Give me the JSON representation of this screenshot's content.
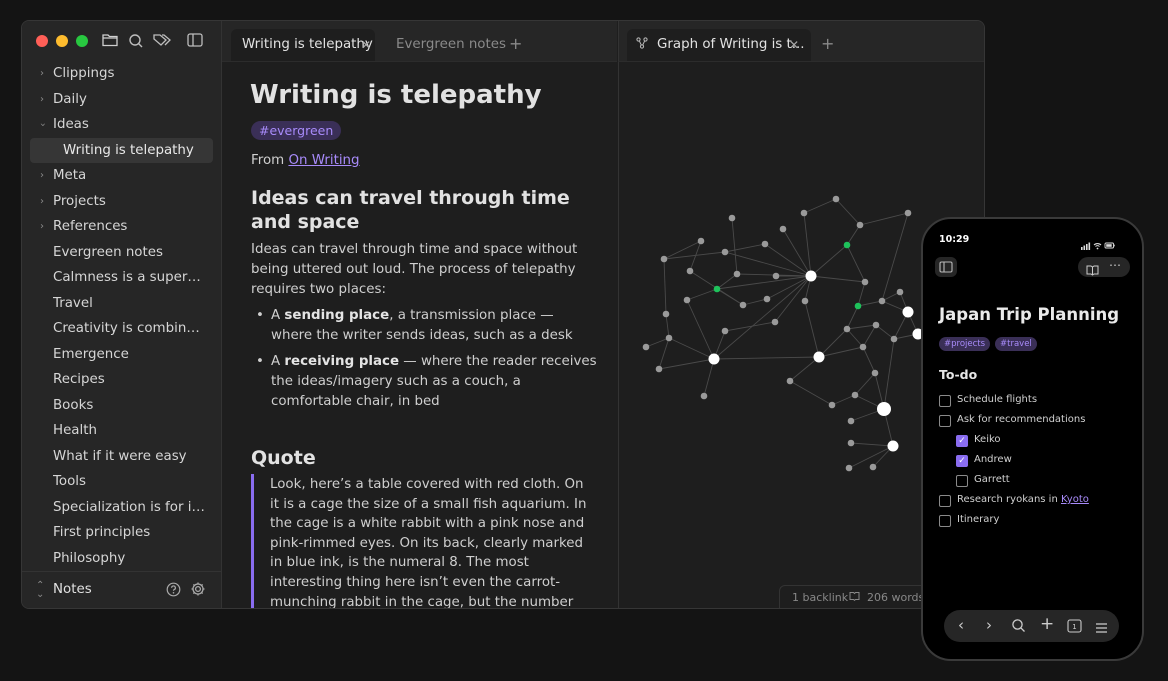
{
  "sidebar": {
    "folders": [
      {
        "label": "Clippings",
        "expanded": false
      },
      {
        "label": "Daily",
        "expanded": false
      },
      {
        "label": "Ideas",
        "expanded": true
      },
      {
        "label": "Writing is telepathy",
        "active": true
      },
      {
        "label": "Meta",
        "expanded": false
      },
      {
        "label": "Projects",
        "expanded": false
      },
      {
        "label": "References",
        "expanded": false
      }
    ],
    "files": [
      "Evergreen notes",
      "Calmness is a superpower",
      "Travel",
      "Creativity is combinatory...",
      "Emergence",
      "Recipes",
      "Books",
      "Health",
      "What if it were easy",
      "Tools",
      "Specialization is for inse...",
      "First principles",
      "Philosophy"
    ],
    "vault_name": "Notes"
  },
  "left_tabs": [
    {
      "label": "Writing is telepathy",
      "active": true
    },
    {
      "label": "Evergreen notes",
      "active": false
    }
  ],
  "right_tabs": [
    {
      "label": "Graph of Writing is t...",
      "active": true
    }
  ],
  "note": {
    "title": "Writing is telepathy",
    "tag": "#evergreen",
    "from_prefix": "From ",
    "from_link": "On Writing",
    "heading1": "Ideas can travel through time and space",
    "paragraph1": "Ideas can travel through time and space without being uttered out loud. The process of telepathy requires two places:",
    "bullet1_pre": "A ",
    "bullet1_bold": "sending place",
    "bullet1_post": ", a transmission place — where the writer sends ideas, such as a desk",
    "bullet2_pre": "A ",
    "bullet2_bold": "receiving place",
    "bullet2_post": " — where the reader receives the ideas/imagery such as a couch, a comfortable chair, in bed",
    "heading2": "Quote",
    "quote": "Look, here’s a table covered with red cloth. On it is a cage the size of a small fish aquarium. In the cage is a white rabbit with a pink nose and pink-rimmed eyes. On its back, clearly marked in blue ink, is the numeral 8. The most interesting thing here isn’t even the carrot-munching rabbit in the cage, but the number on its back. I never opened my mouth and you never opened yours. We’re not even in the"
  },
  "status": {
    "backlinks": "1 backlink",
    "words": "206 words"
  },
  "phone": {
    "time": "10:29",
    "title": "Japan Trip Planning",
    "tags": [
      "#projects",
      "#travel"
    ],
    "section": "To-do",
    "todos": [
      {
        "label": "Schedule flights",
        "checked": false,
        "indent": 0
      },
      {
        "label": "Ask for recommendations",
        "checked": false,
        "indent": 0
      },
      {
        "label": "Keiko",
        "checked": true,
        "indent": 1
      },
      {
        "label": "Andrew",
        "checked": true,
        "indent": 1
      },
      {
        "label": "Garrett",
        "checked": false,
        "indent": 1
      },
      {
        "label": "Research ryokans in ",
        "link": "Kyoto",
        "checked": false,
        "indent": 0
      },
      {
        "label": "Itinerary",
        "checked": false,
        "indent": 0
      }
    ]
  },
  "colors": {
    "accent": "#a88bfa",
    "graph_node": "#9a9a9a",
    "graph_node_highlight": "#1ec25b",
    "graph_node_large": "#ffffff"
  }
}
